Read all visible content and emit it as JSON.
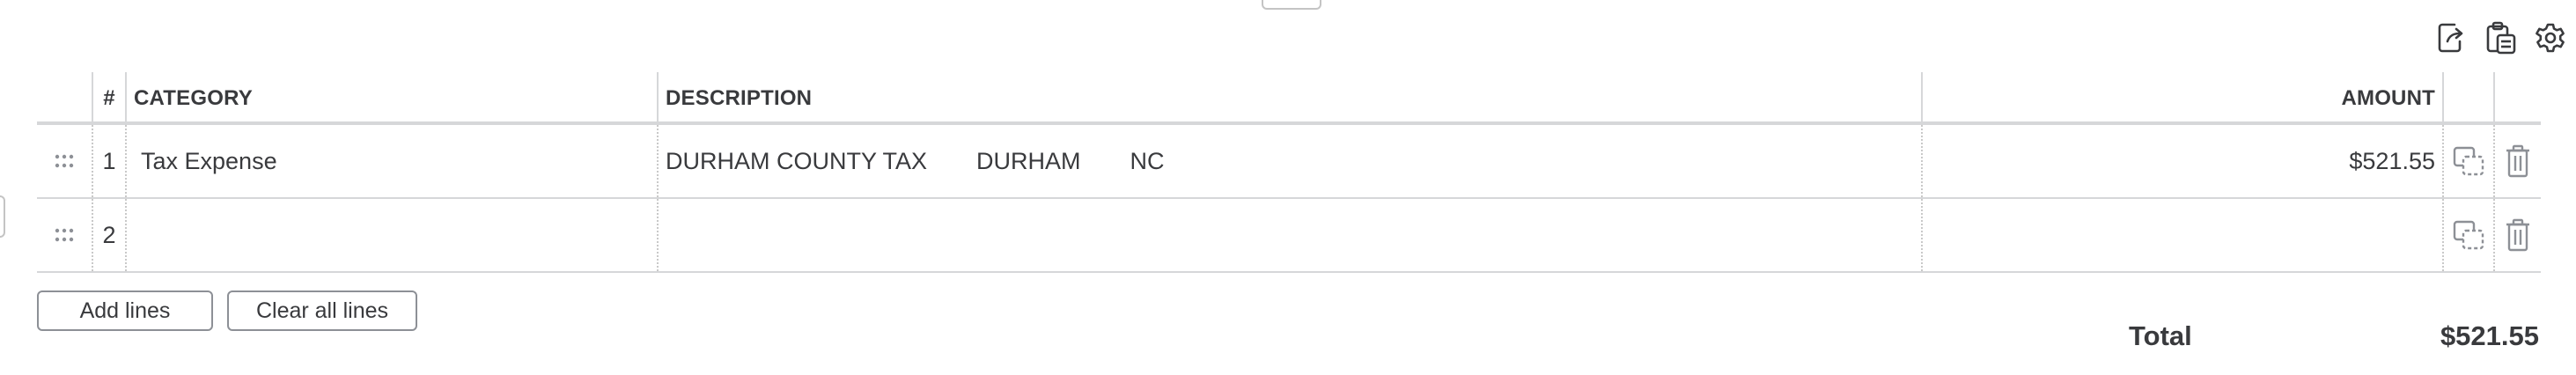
{
  "table": {
    "headers": {
      "num": "#",
      "category": "CATEGORY",
      "description": "DESCRIPTION",
      "amount": "AMOUNT"
    },
    "rows": [
      {
        "num": "1",
        "category": "Tax Expense",
        "description": [
          "DURHAM COUNTY TAX",
          "DURHAM",
          "NC"
        ],
        "amount": "$521.55"
      },
      {
        "num": "2",
        "category": "",
        "description": [
          "",
          "",
          ""
        ],
        "amount": ""
      }
    ]
  },
  "buttons": {
    "add_lines": "Add lines",
    "clear_all_lines": "Clear all lines"
  },
  "total": {
    "label": "Total",
    "value": "$521.55"
  },
  "icons": {
    "toolbar": [
      "export-icon",
      "paste-clipboard-icon",
      "gear-icon"
    ],
    "row": [
      "drag-handle-icon",
      "copy-icon",
      "trash-icon"
    ]
  }
}
